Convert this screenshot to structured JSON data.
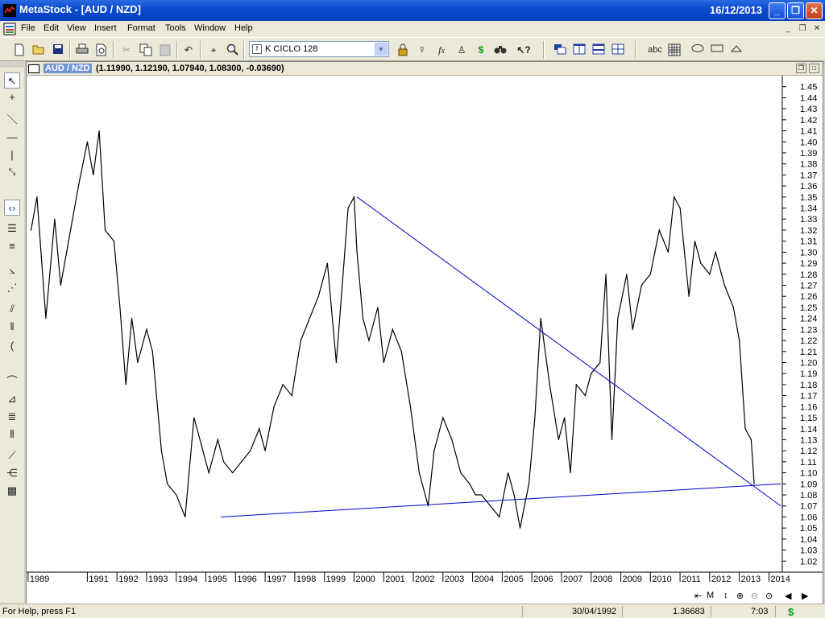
{
  "window": {
    "title": "MetaStock - [AUD / NZD]",
    "date": "16/12/2013",
    "minimize_glyph": "_",
    "restore_glyph": "❐",
    "close_glyph": "✕"
  },
  "menu": [
    "File",
    "Edit",
    "View",
    "Insert",
    "Format",
    "Tools",
    "Window",
    "Help"
  ],
  "mdi_controls": [
    "_",
    "❐",
    "✕"
  ],
  "toolbar": {
    "indicator_combo": {
      "icon": "f",
      "value": "K CICLO 128"
    }
  },
  "chart_window": {
    "name": "AUD / NZD",
    "values": "(1.11990, 1.12190, 1.07940, 1.08300, -0.03690)"
  },
  "status": {
    "help": "For Help, press F1",
    "date": "30/04/1992",
    "value": "1.36683",
    "time": "7:03",
    "dollar": "$",
    "scroll_m": "M"
  },
  "colors": {
    "price_line": "#000000",
    "trendline": "#0000cc",
    "titlebar": "#0a4bd0"
  },
  "chart_data": {
    "type": "line",
    "x_ticks": [
      "1989",
      "1991",
      "1992",
      "1993",
      "1994",
      "1995",
      "1996",
      "1997",
      "1998",
      "1999",
      "2000",
      "2001",
      "2002",
      "2003",
      "2004",
      "2005",
      "2006",
      "2007",
      "2008",
      "2009",
      "2010",
      "2011",
      "2012",
      "2013",
      "2014"
    ],
    "y_ticks": [
      1.02,
      1.03,
      1.04,
      1.05,
      1.06,
      1.07,
      1.08,
      1.09,
      1.1,
      1.11,
      1.12,
      1.13,
      1.14,
      1.15,
      1.16,
      1.17,
      1.18,
      1.19,
      1.2,
      1.21,
      1.22,
      1.23,
      1.24,
      1.25,
      1.26,
      1.27,
      1.28,
      1.29,
      1.3,
      1.31,
      1.32,
      1.33,
      1.34,
      1.35,
      1.36,
      1.37,
      1.38,
      1.39,
      1.4,
      1.41,
      1.42,
      1.43,
      1.44,
      1.45
    ],
    "ylim": [
      1.01,
      1.46
    ],
    "series": [
      {
        "x": [
          1989.1,
          1989.3,
          1989.6,
          1989.9,
          1990.1,
          1990.3,
          1990.5,
          1990.7,
          1991.0,
          1991.2,
          1991.4,
          1991.6,
          1991.9,
          1992.1,
          1992.3,
          1992.5,
          1992.7,
          1993.0,
          1993.2,
          1993.5,
          1993.7,
          1994.0,
          1994.3,
          1994.6,
          1994.9,
          1995.1,
          1995.4,
          1995.6,
          1995.9,
          1996.2,
          1996.5,
          1996.8,
          1997.0,
          1997.3,
          1997.6,
          1997.9,
          1998.2,
          1998.5,
          1998.8,
          1999.1,
          1999.4,
          1999.6,
          1999.8,
          2000.0,
          2000.1,
          2000.3,
          2000.5,
          2000.8,
          2001.0,
          2001.3,
          2001.6,
          2001.9,
          2002.2,
          2002.5,
          2002.7,
          2003.0,
          2003.3,
          2003.6,
          2003.9,
          2004.1,
          2004.3,
          2004.6,
          2004.9,
          2005.2,
          2005.4,
          2005.6,
          2005.9,
          2006.1,
          2006.3,
          2006.6,
          2006.9,
          2007.1,
          2007.3,
          2007.5,
          2007.8,
          2008.0,
          2008.3,
          2008.5,
          2008.7,
          2008.9,
          2009.2,
          2009.4,
          2009.7,
          2010.0,
          2010.3,
          2010.6,
          2010.8,
          2011.0,
          2011.3,
          2011.5,
          2011.7,
          2012.0,
          2012.2,
          2012.5,
          2012.8,
          2013.0,
          2013.2,
          2013.4,
          2013.5
        ],
        "y": [
          1.32,
          1.35,
          1.24,
          1.33,
          1.27,
          1.3,
          1.33,
          1.36,
          1.4,
          1.37,
          1.41,
          1.32,
          1.31,
          1.25,
          1.18,
          1.24,
          1.2,
          1.23,
          1.21,
          1.12,
          1.09,
          1.08,
          1.06,
          1.15,
          1.12,
          1.1,
          1.13,
          1.11,
          1.1,
          1.11,
          1.12,
          1.14,
          1.12,
          1.16,
          1.18,
          1.17,
          1.22,
          1.24,
          1.26,
          1.29,
          1.2,
          1.27,
          1.34,
          1.35,
          1.3,
          1.24,
          1.22,
          1.25,
          1.2,
          1.23,
          1.21,
          1.16,
          1.1,
          1.07,
          1.12,
          1.15,
          1.13,
          1.1,
          1.09,
          1.08,
          1.08,
          1.07,
          1.06,
          1.1,
          1.08,
          1.05,
          1.09,
          1.15,
          1.24,
          1.18,
          1.13,
          1.15,
          1.1,
          1.18,
          1.17,
          1.19,
          1.2,
          1.28,
          1.13,
          1.24,
          1.28,
          1.23,
          1.27,
          1.28,
          1.32,
          1.3,
          1.35,
          1.34,
          1.26,
          1.31,
          1.29,
          1.28,
          1.3,
          1.27,
          1.25,
          1.22,
          1.14,
          1.13,
          1.09
        ]
      }
    ],
    "trendlines": [
      {
        "x": [
          2000.1,
          2014.4
        ],
        "y": [
          1.35,
          1.07
        ]
      },
      {
        "x": [
          1995.5,
          2014.4
        ],
        "y": [
          1.06,
          1.09
        ]
      }
    ]
  }
}
